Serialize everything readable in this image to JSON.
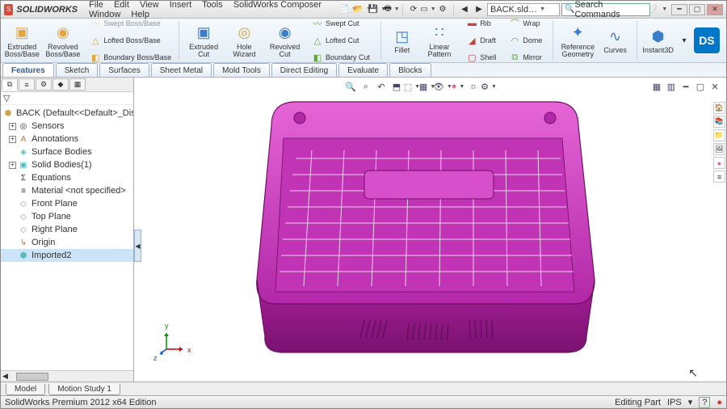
{
  "title": {
    "app_name": "SOLIDWORKS"
  },
  "menu": {
    "file": "File",
    "edit": "Edit",
    "view": "View",
    "insert": "Insert",
    "tools": "Tools",
    "composer": "SolidWorks Composer",
    "window": "Window",
    "help": "Help"
  },
  "title_tools": {
    "doc_name": "BACK.sld…",
    "search_placeholder": "Search Commands"
  },
  "ribbon": {
    "extruded_boss": "Extruded Boss/Base",
    "revolved_boss": "Revolved Boss/Base",
    "swept_boss": "Swept Boss/Base",
    "lofted_boss": "Lofted Boss/Base",
    "boundary_boss": "Boundary Boss/Base",
    "extruded_cut": "Extruded Cut",
    "hole_wizard": "Hole Wizard",
    "revolved_cut": "Revolved Cut",
    "swept_cut": "Swept Cut",
    "lofted_cut": "Lofted Cut",
    "boundary_cut": "Boundary Cut",
    "fillet": "Fillet",
    "linear_pattern": "Linear Pattern",
    "rib": "Rib",
    "draft": "Draft",
    "shell": "Shell",
    "wrap": "Wrap",
    "dome": "Dome",
    "mirror": "Mirror",
    "ref_geometry": "Reference Geometry",
    "curves": "Curves",
    "instant3d": "Instant3D"
  },
  "tabs": {
    "features": "Features",
    "sketch": "Sketch",
    "surfaces": "Surfaces",
    "sheet_metal": "Sheet Metal",
    "mold_tools": "Mold Tools",
    "direct_editing": "Direct Editing",
    "evaluate": "Evaluate",
    "blocks": "Blocks"
  },
  "tree": {
    "root": "BACK  (Default<<Default>_Displa",
    "items": [
      "Sensors",
      "Annotations",
      "Surface Bodies",
      "Solid Bodies(1)",
      "Equations",
      "Material <not specified>",
      "Front Plane",
      "Top Plane",
      "Right Plane",
      "Origin",
      "Imported2"
    ]
  },
  "triad": {
    "x": "x",
    "y": "y",
    "z": "z"
  },
  "bottom_tabs": {
    "model": "Model",
    "motion": "Motion Study 1"
  },
  "status": {
    "left": "SolidWorks Premium 2012 x64 Edition",
    "editing": "Editing Part",
    "units": "IPS"
  }
}
